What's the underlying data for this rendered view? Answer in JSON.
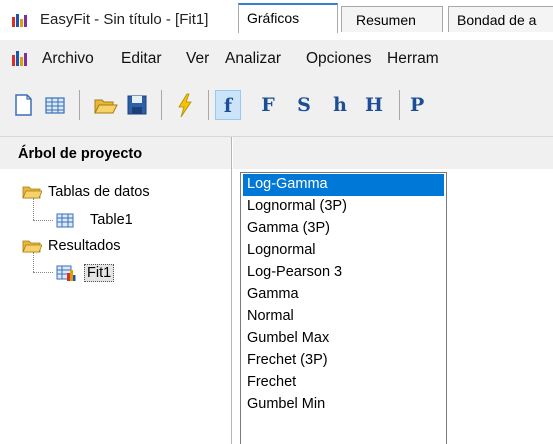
{
  "window": {
    "title": "EasyFit - Sin título - [Fit1]"
  },
  "menu": {
    "items": [
      "Archivo",
      "Editar",
      "Ver",
      "Analizar",
      "Opciones",
      "Herram"
    ]
  },
  "toolbar": {
    "letters": [
      "f",
      "F",
      "S",
      "h",
      "H",
      "P"
    ]
  },
  "left_panel": {
    "header": "Árbol de proyecto",
    "tree": {
      "folder1": "Tablas de datos",
      "table1": "Table1",
      "folder2": "Resultados",
      "fit1": "Fit1"
    }
  },
  "tabs": [
    "Gráficos",
    "Resumen",
    "Bondad de a"
  ],
  "distributions": [
    "Log-Gamma",
    "Lognormal (3P)",
    "Gamma (3P)",
    "Lognormal",
    "Log-Pearson 3",
    "Gamma",
    "Normal",
    "Gumbel Max",
    "Frechet (3P)",
    "Frechet",
    "Gumbel Min"
  ],
  "selected_distribution": "Log-Gamma",
  "colors": {
    "selection": "#0078d7",
    "tab_accent": "#3a7bd5",
    "toolbar_letters": "#1c4e96"
  }
}
